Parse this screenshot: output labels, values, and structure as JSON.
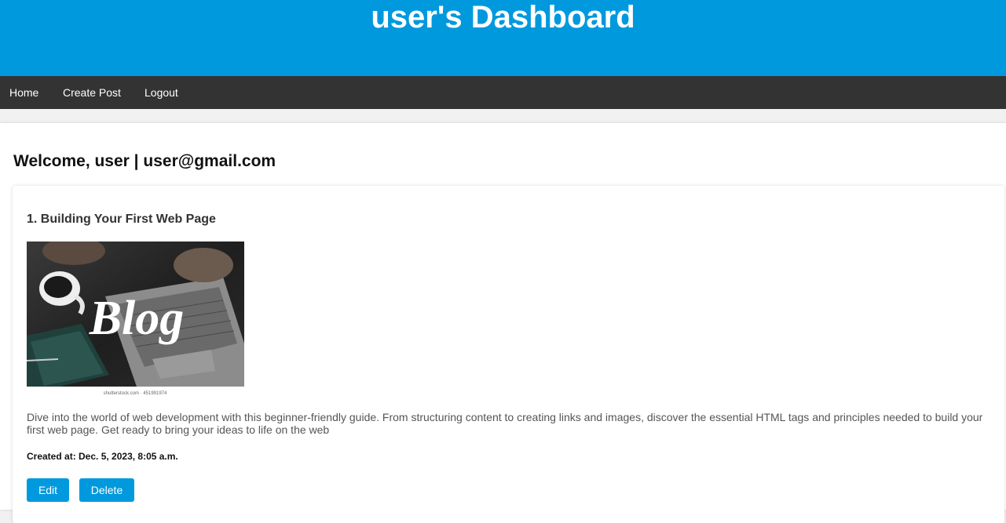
{
  "header": {
    "title": "user's Dashboard"
  },
  "nav": {
    "home": "Home",
    "create_post": "Create Post",
    "logout": "Logout"
  },
  "welcome": "Welcome, user | user@gmail.com",
  "posts": [
    {
      "title": "1. Building Your First Web Page",
      "image_text": "Blog",
      "image_credit": "shutterstock.com · 451991974",
      "body": "Dive into the world of web development with this beginner-friendly guide. From structuring content to creating links and images, discover the essential HTML tags and principles needed to build your first web page. Get ready to bring your ideas to life on the web",
      "created": "Created at: Dec. 5, 2023, 8:05 a.m.",
      "edit_label": "Edit",
      "delete_label": "Delete"
    }
  ],
  "colors": {
    "header_bg": "#0099dd",
    "nav_bg": "#333333",
    "button_bg": "#0099dd"
  }
}
